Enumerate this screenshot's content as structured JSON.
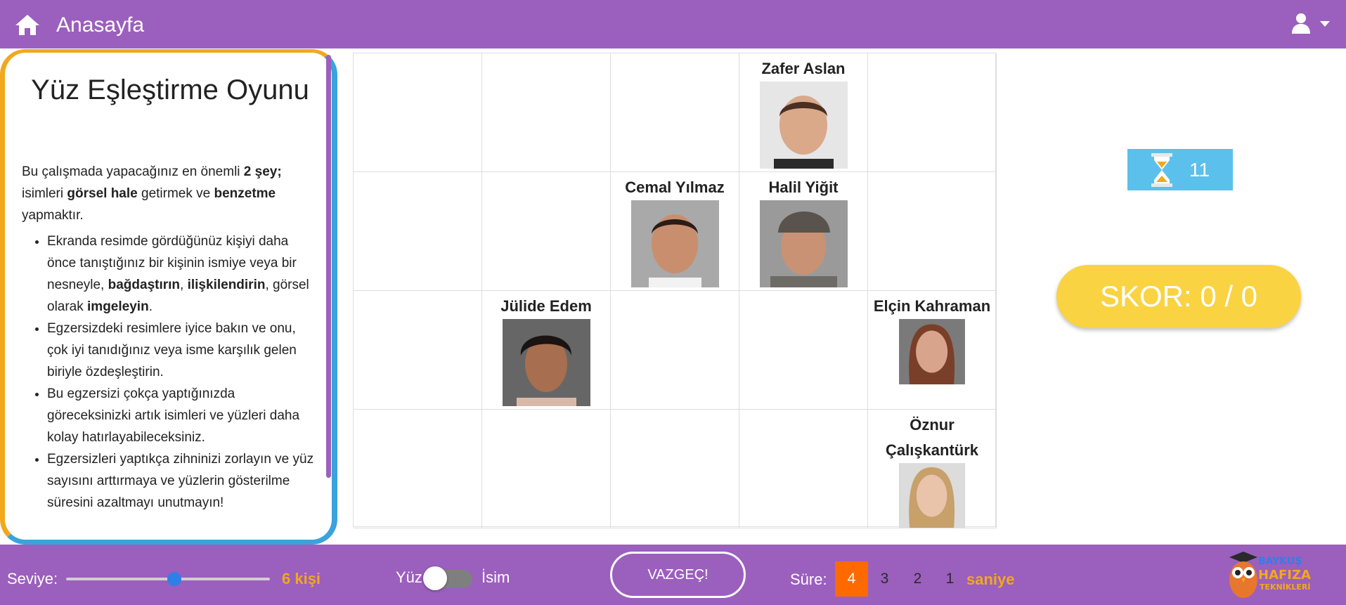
{
  "topbar": {
    "title": "Anasayfa"
  },
  "panel": {
    "title": "Yüz Eşleştirme Oyunu",
    "intro_1": "Bu çalışmada yapacağınız en önemli ",
    "intro_bold_1": "2 şey;",
    "intro_2": " isimleri ",
    "intro_bold_2": "görsel hale",
    "intro_3": " getirmek ve ",
    "intro_bold_3": "benzetme",
    "intro_4": " yapmaktır.",
    "b1_a": "Ekranda resimde gördüğünüz kişiyi daha önce tanıştığınız bir kişinin ismiye veya bir nesneyle, ",
    "b1_bold_a": "bağdaştırın",
    "b1_b": ", ",
    "b1_bold_b": "ilişkilendirin",
    "b1_c": ", görsel olarak ",
    "b1_bold_c": "imgeleyin",
    "b1_d": ".",
    "b2": "Egzersizdeki resimlere iyice bakın ve onu, çok iyi tanıdığınız veya isme karşılık gelen biriyle özdeşleştirin.",
    "b3": "Bu egzersizi çokça yaptığınızda göreceksinizki artık isimleri ve yüzleri daha kolay hatırlayabileceksiniz.",
    "b4": "Egzersizleri yaptıkça zihninizi zorlayın ve yüz sayısını arttırmaya ve yüzlerin gösterilme süresini azaltmayı unutmayın!"
  },
  "grid": {
    "zafer": "Zafer Aslan",
    "cemal": "Cemal Yılmaz",
    "halil": "Halil Yiğit",
    "julide": "Jülide Edem",
    "elcin": "Elçin Kahraman",
    "oznur": "Öznur Çalışkantürk"
  },
  "timer": {
    "value": "11"
  },
  "score": {
    "label": "SKOR: 0 / 0"
  },
  "bottombar": {
    "level_label": "Seviye:",
    "level_value": "6 kişi",
    "level_fraction": 0.53,
    "face_label": "Yüz",
    "name_label": "İsim",
    "cancel_label": "VAZGEÇ!",
    "duration_label": "Süre:",
    "durations": [
      "4",
      "3",
      "2",
      "1"
    ],
    "duration_unit": "saniye",
    "logo_line1": "BAYKUŞ",
    "logo_line2": "HAFIZA",
    "logo_line3": "TEKNİKLERİ"
  },
  "colors": {
    "brand": "#9b5fbd",
    "accent": "#f2a81d",
    "active": "#ff6a00",
    "score": "#f9d342",
    "timer": "#5bc0eb"
  }
}
